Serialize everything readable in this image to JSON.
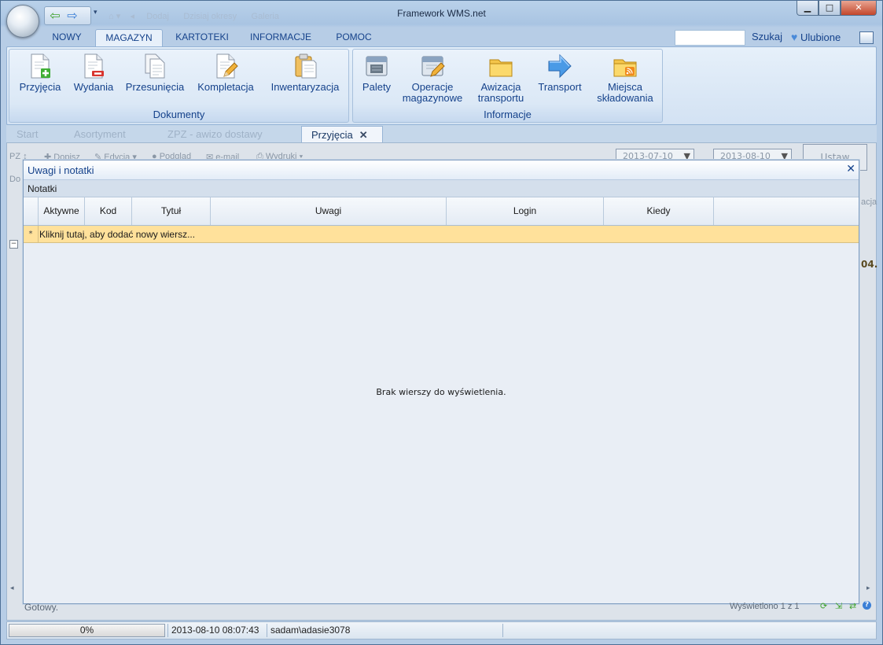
{
  "window": {
    "title": "Framework WMS.net",
    "controls": {
      "minimize": "▁",
      "maximize": "□",
      "close": "✕"
    }
  },
  "ribbon_tabs": [
    {
      "label": "NOWY"
    },
    {
      "label": "MAGAZYN",
      "active": true
    },
    {
      "label": "KARTOTEKI"
    },
    {
      "label": "INFORMACJE"
    },
    {
      "label": "POMOC"
    }
  ],
  "header_right": {
    "search_label": "Szukaj",
    "favorites_label": "Ulubione"
  },
  "ribbon": {
    "dokumenty": {
      "label": "Dokumenty",
      "buttons": [
        {
          "label": "Przyjęcia",
          "icon": "document-add-icon"
        },
        {
          "label": "Wydania",
          "icon": "document-remove-icon"
        },
        {
          "label": "Przesunięcia",
          "icon": "documents-copy-icon"
        },
        {
          "label": "Kompletacja",
          "icon": "document-edit-icon"
        },
        {
          "label": "Inwentaryzacja",
          "icon": "clipboard-icon"
        }
      ]
    },
    "informacje": {
      "label": "Informacje",
      "buttons": [
        {
          "label": "Palety",
          "icon": "pallet-calendar-icon"
        },
        {
          "label1": "Operacje",
          "label2": "magazynowe",
          "icon": "operations-calendar-icon"
        },
        {
          "label1": "Awizacja",
          "label2": "transportu",
          "icon": "folder-icon"
        },
        {
          "label": "Transport",
          "icon": "arrow-right-icon"
        },
        {
          "label1": "Miejsca",
          "label2": "składowania",
          "icon": "rss-folder-icon"
        }
      ]
    }
  },
  "doc_tabs": [
    {
      "label": "Start"
    },
    {
      "label": "Asortyment"
    },
    {
      "label": "ZPZ - awizo dostawy"
    },
    {
      "label": "Przyjęcia",
      "active": true,
      "close": "✕"
    }
  ],
  "background_toolbar": {
    "pz": "PZ",
    "dopisz": "Dopisz",
    "edycja": "Edycja",
    "podglad": "Podgląd",
    "email": "e-mail",
    "wydruki": "Wydruki",
    "date_from": "2013-07-10",
    "date_to": "2013-08-10",
    "ustaw": "Ustaw",
    "do_fragment": "Do",
    "acja_fragment": "acja",
    "value_fragment": "04."
  },
  "dialog": {
    "title": "Uwagi i notatki",
    "close": "✕",
    "section": "Notatki",
    "columns": [
      "Aktywne",
      "Kod",
      "Tytuł",
      "Uwagi",
      "Login",
      "Kiedy"
    ],
    "new_row_marker": "*",
    "new_row_text": "Kliknij tutaj, aby dodać nowy wiersz...",
    "empty_text": "Brak wierszy do wyświetlenia."
  },
  "status_line": {
    "left": "Gotowy.",
    "right": "Wyświetlono 1 z 1"
  },
  "status_bar": {
    "progress_text": "0%",
    "progress_value": 0,
    "datetime": "2013-08-10 08:07:43",
    "user": "sadam\\adasie3078"
  },
  "colors": {
    "accent": "#15428b",
    "new_row": "#ffe19b",
    "ribbon": "#dbe8f6"
  }
}
